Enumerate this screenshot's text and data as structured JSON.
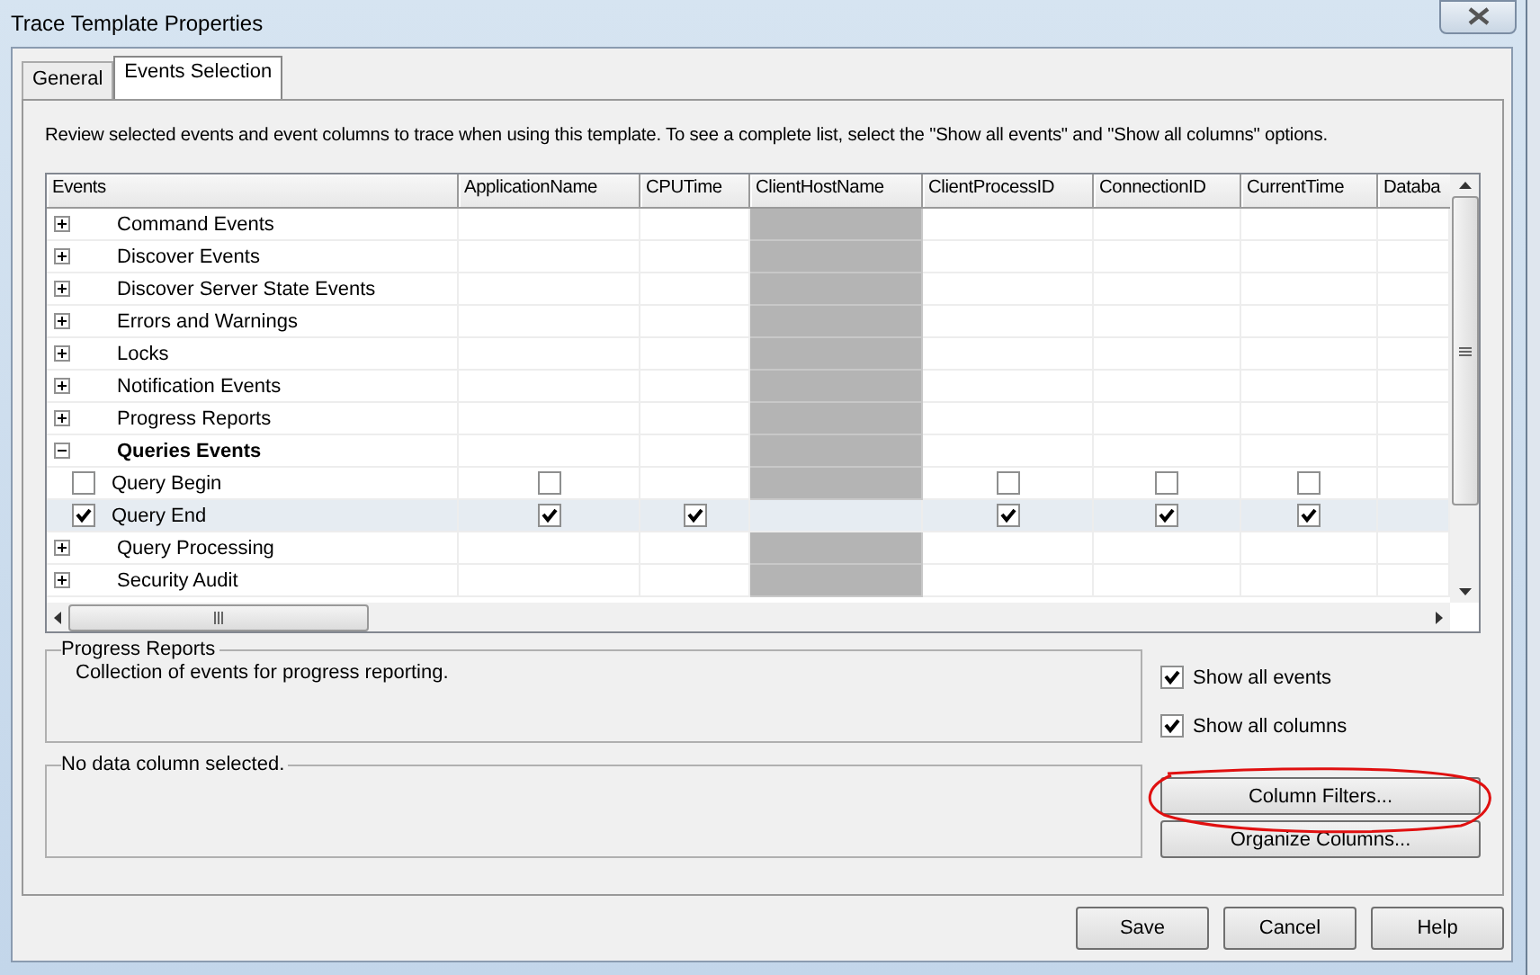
{
  "window": {
    "title": "Trace Template Properties"
  },
  "tabs": [
    {
      "label": "General",
      "selected": false
    },
    {
      "label": "Events Selection",
      "selected": true
    }
  ],
  "description": "Review selected events and event columns to trace when using this template. To see a complete list, select the \"Show all events\" and \"Show all columns\" options.",
  "grid": {
    "columns": [
      {
        "label": "Events"
      },
      {
        "label": "ApplicationName"
      },
      {
        "label": "CPUTime"
      },
      {
        "label": "ClientHostName",
        "shaded": true
      },
      {
        "label": "ClientProcessID"
      },
      {
        "label": "ConnectionID"
      },
      {
        "label": "CurrentTime"
      },
      {
        "label": "Databa"
      }
    ],
    "rows": [
      {
        "kind": "group",
        "label": "Command Events",
        "expanded": false,
        "selected": false
      },
      {
        "kind": "group",
        "label": "Discover Events",
        "expanded": false,
        "selected": false
      },
      {
        "kind": "group",
        "label": "Discover Server State Events",
        "expanded": false,
        "selected": false
      },
      {
        "kind": "group",
        "label": "Errors and Warnings",
        "expanded": false,
        "selected": false
      },
      {
        "kind": "group",
        "label": "Locks",
        "expanded": false,
        "selected": false
      },
      {
        "kind": "group",
        "label": "Notification Events",
        "expanded": false,
        "selected": false
      },
      {
        "kind": "group",
        "label": "Progress Reports",
        "expanded": false,
        "selected": false
      },
      {
        "kind": "group",
        "label": "Queries Events",
        "expanded": true,
        "selected": false
      },
      {
        "kind": "event",
        "label": "Query Begin",
        "checked": false,
        "selected": false,
        "cells": [
          {
            "kind": "checkbox",
            "checked": false
          },
          {
            "kind": "blank"
          },
          {
            "kind": "blank"
          },
          {
            "kind": "checkbox",
            "checked": false
          },
          {
            "kind": "checkbox",
            "checked": false
          },
          {
            "kind": "checkbox",
            "checked": false
          },
          {
            "kind": "blank"
          }
        ]
      },
      {
        "kind": "event",
        "label": "Query End",
        "checked": true,
        "selected": true,
        "cells": [
          {
            "kind": "checkbox",
            "checked": true
          },
          {
            "kind": "checkbox",
            "checked": true
          },
          {
            "kind": "blank"
          },
          {
            "kind": "checkbox",
            "checked": true
          },
          {
            "kind": "checkbox",
            "checked": true
          },
          {
            "kind": "checkbox",
            "checked": true
          },
          {
            "kind": "blank"
          }
        ]
      },
      {
        "kind": "group",
        "label": "Query Processing",
        "expanded": false,
        "selected": false
      },
      {
        "kind": "group",
        "label": "Security Audit",
        "expanded": false,
        "selected": false
      }
    ]
  },
  "event_info": {
    "title": "Progress Reports",
    "text": "Collection of events for progress reporting."
  },
  "column_info": {
    "title": "No data column selected."
  },
  "options": [
    {
      "label": "Show all events",
      "checked": true
    },
    {
      "label": "Show all columns",
      "checked": true
    }
  ],
  "column_buttons": [
    "Column Filters...",
    "Organize Columns..."
  ],
  "buttons": [
    "Save",
    "Cancel",
    "Help"
  ]
}
